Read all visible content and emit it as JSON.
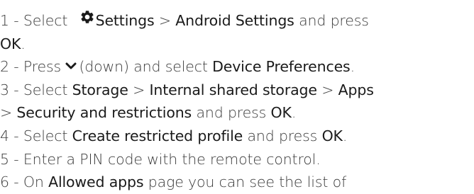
{
  "steps": [
    {
      "line1": {
        "num": "1 - ",
        "t1": "Select ",
        "icon": "gear-icon",
        "settings": "Settings",
        "sep": " > ",
        "android_settings": "Android Settings",
        "t2": " and press"
      },
      "line2": {
        "ok": "OK",
        "t3": "."
      }
    },
    {
      "num": "2 - ",
      "t1": "Press ",
      "icon": "chevron-down-icon",
      "t2": "(down) and select ",
      "device_preferences": "Device Preferences",
      "t3": "."
    },
    {
      "line1": {
        "num": "3 - ",
        "t1": "Select ",
        "storage": "Storage",
        "sep1": " > ",
        "internal_storage": "Internal shared storage",
        "sep2": " > ",
        "apps": "Apps"
      },
      "line2": {
        "sep3": "> ",
        "security": "Security and restrictions",
        "t2": " and press ",
        "ok": "OK",
        "t3": "."
      }
    },
    {
      "num": "4 - ",
      "t1": "Select ",
      "create_profile": "Create restricted profile",
      "t2": " and press ",
      "ok": "OK",
      "t3": "."
    },
    {
      "num": "5 - ",
      "t1": "Enter a PIN code with the remote control."
    },
    {
      "num": "6 - ",
      "t1": "On ",
      "allowed_apps": "Allowed apps",
      "t2": " page you can see the list of"
    }
  ]
}
